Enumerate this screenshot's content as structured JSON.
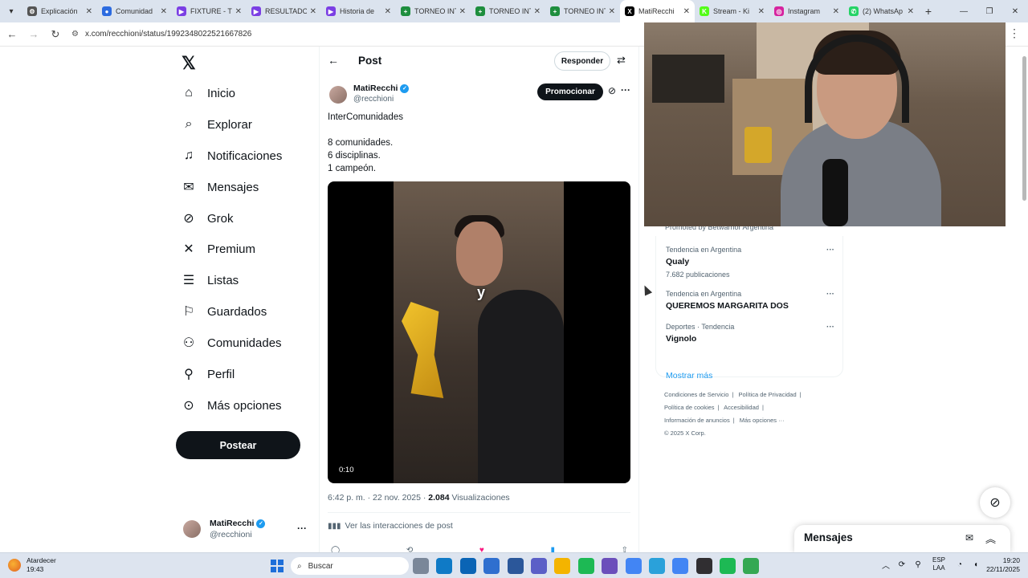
{
  "browser": {
    "tabs": [
      {
        "title": "Explicación",
        "color": "#555555",
        "glyph": "⚙"
      },
      {
        "title": "Comunidad",
        "color": "#2c6be0",
        "glyph": "●"
      },
      {
        "title": "FIXTURE - Tu",
        "color": "#7b3fe4",
        "glyph": "▶"
      },
      {
        "title": "RESULTADO",
        "color": "#7b3fe4",
        "glyph": "▶"
      },
      {
        "title": "Historia de",
        "color": "#7b3fe4",
        "glyph": "▶"
      },
      {
        "title": "TORNEO INT",
        "color": "#1e8e3e",
        "glyph": "+"
      },
      {
        "title": "TORNEO INT",
        "color": "#1e8e3e",
        "glyph": "+"
      },
      {
        "title": "TORNEO INT",
        "color": "#1e8e3e",
        "glyph": "+"
      },
      {
        "title": "MatiRecchi",
        "color": "#000000",
        "glyph": "X",
        "active": true
      },
      {
        "title": "Stream - Ki",
        "color": "#53fc18",
        "glyph": "K"
      },
      {
        "title": "Instagram",
        "color": "#d6249f",
        "glyph": "◎"
      },
      {
        "title": "(2) WhatsAp",
        "color": "#25d366",
        "glyph": "✆"
      }
    ],
    "url": "x.com/recchioni/status/1992348022521667826"
  },
  "nav": {
    "items": [
      {
        "label": "Inicio",
        "icon": "⌂"
      },
      {
        "label": "Explorar",
        "icon": "⌕"
      },
      {
        "label": "Notificaciones",
        "icon": "♫"
      },
      {
        "label": "Mensajes",
        "icon": "✉"
      },
      {
        "label": "Grok",
        "icon": "⊘"
      },
      {
        "label": "Premium",
        "icon": "✕"
      },
      {
        "label": "Listas",
        "icon": "☰"
      },
      {
        "label": "Guardados",
        "icon": "⚐"
      },
      {
        "label": "Comunidades",
        "icon": "⚇"
      },
      {
        "label": "Perfil",
        "icon": "⚲"
      },
      {
        "label": "Más opciones",
        "icon": "⊙"
      }
    ],
    "post_button": "Postear",
    "account": {
      "name": "MatiRecchi",
      "handle": "@recchioni"
    }
  },
  "header": {
    "title": "Post",
    "reply_button": "Responder"
  },
  "post": {
    "author_name": "MatiRecchi",
    "author_handle": "@recchioni",
    "promote_button": "Promocionar",
    "line1": "InterComunidades",
    "line2": "8 comunidades.",
    "line3": "6 disciplinas.",
    "line4": "1 campeón.",
    "video_caption": "y",
    "video_time": "0:10",
    "time": "6:42 p. m. · 22 nov. 2025 · ",
    "views_count": "2.084",
    "views_label": " Visualizaciones",
    "interactions_link": "Ver las interacciones de post"
  },
  "sidebar": {
    "promoted": "Promoted by Betwarrior Argentina",
    "trends": [
      {
        "category": "Tendencia en Argentina",
        "name": "Qualy",
        "count": "7.682 publicaciones"
      },
      {
        "category": "Tendencia en Argentina",
        "name": "QUEREMOS MARGARITA DOS",
        "count": ""
      },
      {
        "category": "Deportes · Tendencia",
        "name": "Vignolo",
        "count": ""
      }
    ],
    "show_more": "Mostrar más",
    "footer": {
      "terms": "Condiciones de Servicio",
      "privacy": "Política de Privacidad",
      "cookies": "Política de cookies",
      "accessibility": "Accesibilidad",
      "ads": "Información de anuncios",
      "more": "Más opciones ···",
      "copyright": "© 2025 X Corp."
    }
  },
  "messages_drawer": {
    "title": "Mensajes"
  },
  "taskbar": {
    "weather_label": "Atardecer",
    "weather_time": "19:43",
    "search_placeholder": "Buscar",
    "lang_top": "ESP",
    "lang_bottom": "LAA",
    "clock_time": "19:20",
    "clock_date": "22/11/2025",
    "apps": [
      {
        "name": "task-view",
        "color": "#7a8799"
      },
      {
        "name": "edge",
        "color": "#0f7ac6"
      },
      {
        "name": "outlook",
        "color": "#0a64b5"
      },
      {
        "name": "store",
        "color": "#2f6fcf"
      },
      {
        "name": "word",
        "color": "#2b579a"
      },
      {
        "name": "teams",
        "color": "#5b5fc7"
      },
      {
        "name": "files",
        "color": "#f4b400"
      },
      {
        "name": "spotify",
        "color": "#1db954"
      },
      {
        "name": "clipchamp",
        "color": "#6b4fbb"
      },
      {
        "name": "chrome",
        "color": "#4285f4"
      },
      {
        "name": "telegram",
        "color": "#2aa1da"
      },
      {
        "name": "chrome-2",
        "color": "#4285f4"
      },
      {
        "name": "obs",
        "color": "#302e31"
      },
      {
        "name": "spotify-2",
        "color": "#1db954"
      },
      {
        "name": "chrome-3",
        "color": "#34a853"
      }
    ]
  }
}
